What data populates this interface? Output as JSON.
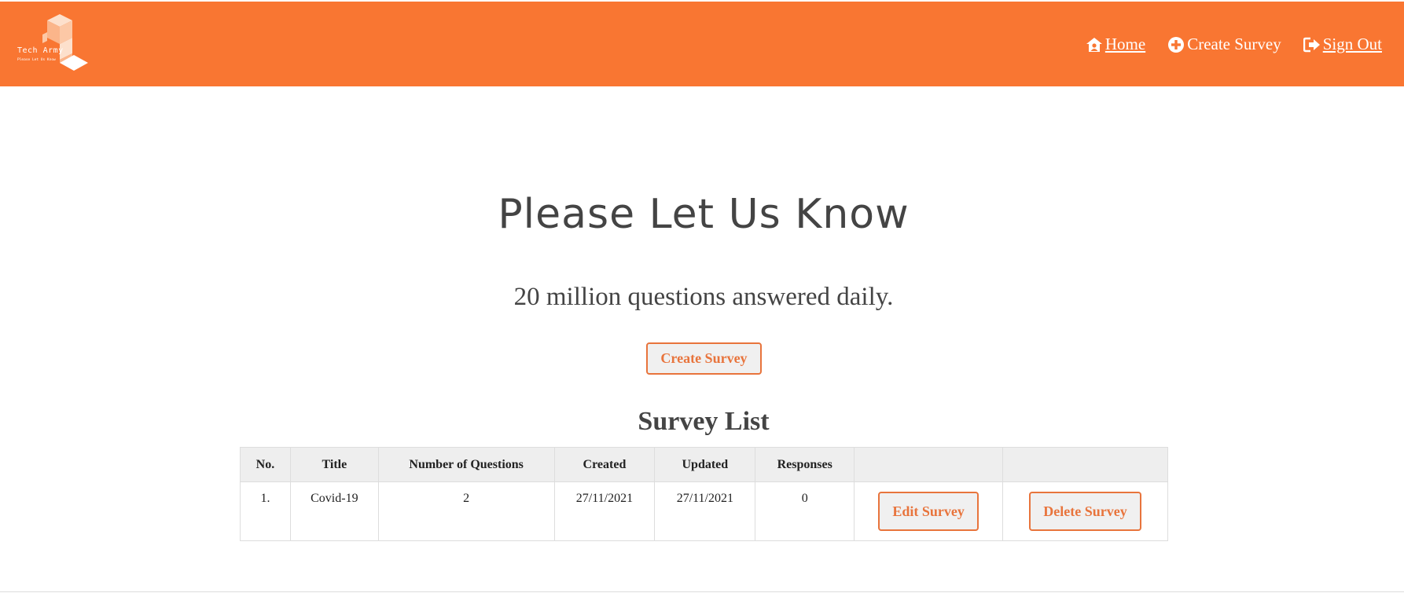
{
  "brand": {
    "name": "Tech Army",
    "tagline": "Please Let Us Know",
    "color": "#f97632"
  },
  "nav": {
    "home": "Home",
    "create_survey": "Create Survey",
    "sign_out": "Sign Out"
  },
  "hero": {
    "title": "Please Let Us Know",
    "subtitle": "20 million questions answered daily.",
    "button": "Create Survey"
  },
  "survey_list": {
    "title": "Survey List",
    "columns": [
      "No.",
      "Title",
      "Number of Questions",
      "Created",
      "Updated",
      "Responses",
      "",
      ""
    ],
    "rows": [
      {
        "no": "1.",
        "title": "Covid-19",
        "questions": "2",
        "created": "27/11/2021",
        "updated": "27/11/2021",
        "responses": "0",
        "edit_label": "Edit Survey",
        "delete_label": "Delete Survey"
      }
    ]
  },
  "colors": {
    "accent": "#f97632",
    "button_text": "#e8743c",
    "text": "#444444"
  }
}
